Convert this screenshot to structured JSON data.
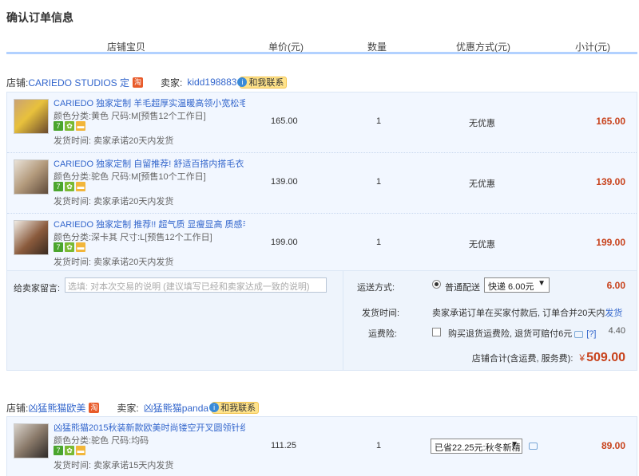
{
  "page_title": "确认订单信息",
  "headers": {
    "item": "店铺宝贝",
    "price": "单价(元)",
    "qty": "数量",
    "discount": "优惠方式(元)",
    "subtotal": "小计(元)"
  },
  "shop1": {
    "shop_label": "店铺:",
    "shop_name": "CARIEDO STUDIOS 定",
    "seller_label": "卖家:",
    "seller_name": "kidd198883",
    "contact_label": "和我联系",
    "items": [
      {
        "title": "CARIEDO 独家定制 羊毛超厚实温暖高领小宽松毛 ...",
        "sku": "颜色分类:黄色  尺码:M[预售12个工作日]",
        "ship": "发货时间:  卖家承诺20天内发货",
        "price": "165.00",
        "qty": "1",
        "discount": "无优惠",
        "subtotal": "165.00"
      },
      {
        "title": "CARIEDO 独家定制 自留推荐! 舒适百搭内搭毛衣 ...",
        "sku": "颜色分类:驼色  尺码:M[预售10个工作日]",
        "ship": "发货时间:  卖家承诺20天内发货",
        "price": "139.00",
        "qty": "1",
        "discount": "无优惠",
        "subtotal": "139.00"
      },
      {
        "title": "CARIEDO 独家定制 推荐!! 超气质 显瘦显高 质感毛 ...",
        "sku": "颜色分类:深卡其  尺寸:L[预售12个工作日]",
        "ship": "发货时间:  卖家承诺20天内发货",
        "price": "199.00",
        "qty": "1",
        "discount": "无优惠",
        "subtotal": "199.00"
      }
    ],
    "message_label": "给卖家留言:",
    "message_placeholder": "选填: 对本次交易的说明 (建议填写已经和卖家达成一致的说明)",
    "delivery_label": "运送方式:",
    "delivery_option": "普通配送",
    "delivery_select": "快递 6.00元",
    "delivery_fee": "6.00",
    "ship_time_label": "发货时间:",
    "ship_time_text": "卖家承诺订单在买家付款后, 订单合并20天内",
    "ship_time_link": "发货",
    "insurance_label": "运费险:",
    "insurance_text": "购买退货运费险, 退货可赔付6元",
    "insurance_help": "[?]",
    "insurance_fee": "4.40",
    "total_label": "店铺合计(含运费, 服务费):",
    "total_currency": "¥",
    "total_amount": "509.00"
  },
  "shop2": {
    "shop_label": "店铺:",
    "shop_name": "凶猛熊猫欧美",
    "seller_label": "卖家:",
    "seller_name": "凶猛熊猫panda",
    "contact_label": "和我联系",
    "items": [
      {
        "title": "凶猛熊猫2015秋装新款欧美时尚镂空开叉圆领针织 ...",
        "sku": "颜色分类:驼色  尺码:均码",
        "ship": "发货时间:  卖家承诺15天内发货",
        "price": "111.25",
        "qty": "1",
        "discount": "已省22.25元:秋冬新精",
        "subtotal": "89.00"
      }
    ]
  },
  "icons": {
    "badge7": "7",
    "colors": {
      "link": "#3366cc",
      "price": "#c8431d",
      "row_bg": "#f2f7ff",
      "header_line": "#b2d1ff"
    }
  }
}
